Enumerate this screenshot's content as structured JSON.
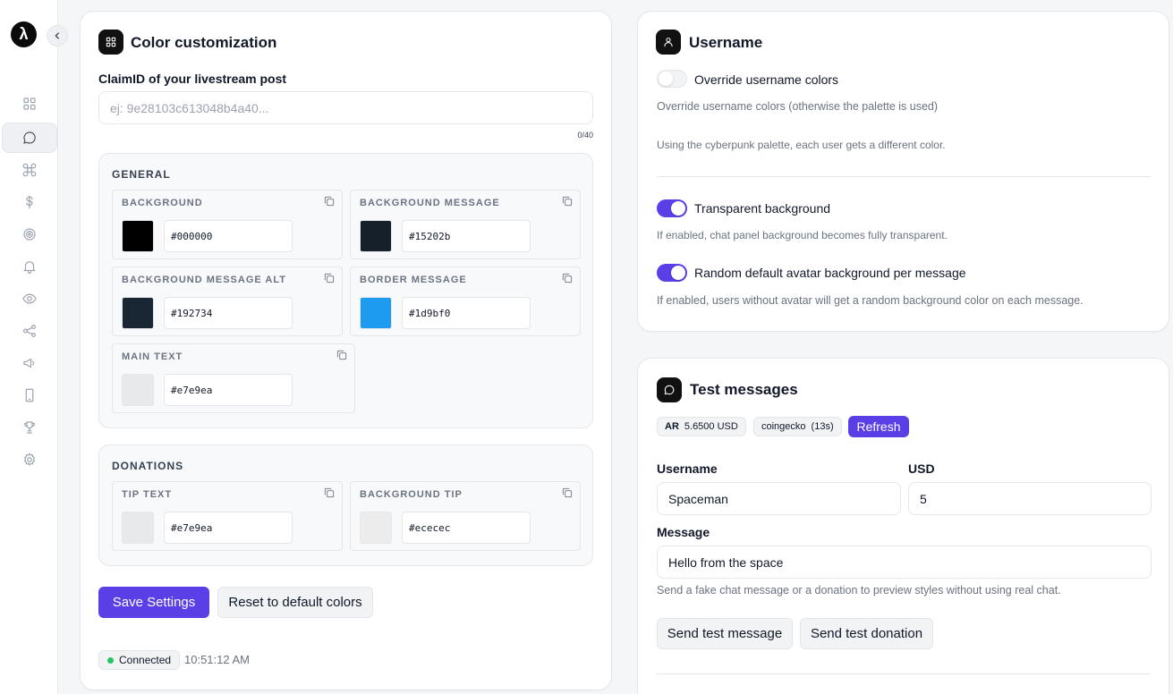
{
  "sidebar": {
    "logo_glyph": "λ",
    "nav": [
      {
        "icon": "grid-icon"
      },
      {
        "icon": "chat-bubble-icon",
        "active": true
      },
      {
        "icon": "command-icon"
      },
      {
        "icon": "dollar-icon"
      },
      {
        "icon": "target-icon"
      },
      {
        "icon": "bell-icon"
      },
      {
        "icon": "eye-icon"
      },
      {
        "icon": "share-icon"
      },
      {
        "icon": "megaphone-icon"
      },
      {
        "icon": "phone-icon"
      },
      {
        "icon": "trophy-icon"
      },
      {
        "icon": "gear-icon"
      }
    ]
  },
  "color_card": {
    "title": "Color customization",
    "claim_label": "ClaimID of your livestream post",
    "claim_placeholder": "ej: 9e28103c613048b4a40...",
    "claim_value": "",
    "char_count": "0/40",
    "general": {
      "title": "GENERAL",
      "items": [
        {
          "label": "BACKGROUND",
          "hex": "#000000",
          "color": "#000000"
        },
        {
          "label": "BACKGROUND MESSAGE",
          "hex": "#15202b",
          "color": "#15202b"
        },
        {
          "label": "BACKGROUND MESSAGE ALT",
          "hex": "#192734",
          "color": "#192734"
        },
        {
          "label": "BORDER MESSAGE",
          "hex": "#1d9bf0",
          "color": "#1d9bf0"
        },
        {
          "label": "MAIN TEXT",
          "hex": "#e7e9ea",
          "color": "#e7e9ea"
        }
      ]
    },
    "donations": {
      "title": "DONATIONS",
      "items": [
        {
          "label": "TIP TEXT",
          "hex": "#e7e9ea",
          "color": "#e7e9ea"
        },
        {
          "label": "BACKGROUND TIP",
          "hex": "#ececec",
          "color": "#ececec"
        }
      ]
    },
    "save_label": "Save Settings",
    "reset_label": "Reset to default colors",
    "status": "Connected",
    "time": "10:51:12 AM"
  },
  "username_card": {
    "title": "Username",
    "override_label": "Override username colors",
    "override_on": false,
    "override_help": "Override username colors (otherwise the palette is used)",
    "palette_help": "Using the cyberpunk palette, each user gets a different color.",
    "transparent_label": "Transparent background",
    "transparent_on": true,
    "transparent_help": "If enabled, chat panel background becomes fully transparent.",
    "random_label": "Random default avatar background per message",
    "random_on": true,
    "random_help": "If enabled, users without avatar will get a random background color on each message."
  },
  "test_card": {
    "title": "Test messages",
    "price_chip_symbol": "AR",
    "price_chip_value": "5.6500 USD",
    "source_chip_name": "coingecko",
    "source_chip_age": "(13s)",
    "refresh_label": "Refresh",
    "username_label": "Username",
    "username_value": "Spaceman",
    "usd_label": "USD",
    "usd_value": "5",
    "message_label": "Message",
    "message_value": "Hello from the space",
    "help": "Send a fake chat message or a donation to preview styles without using real chat.",
    "send_message_label": "Send test message",
    "send_donation_label": "Send test donation"
  },
  "colors": {
    "accent": "#5b3fe6",
    "connected": "#22c55e"
  }
}
